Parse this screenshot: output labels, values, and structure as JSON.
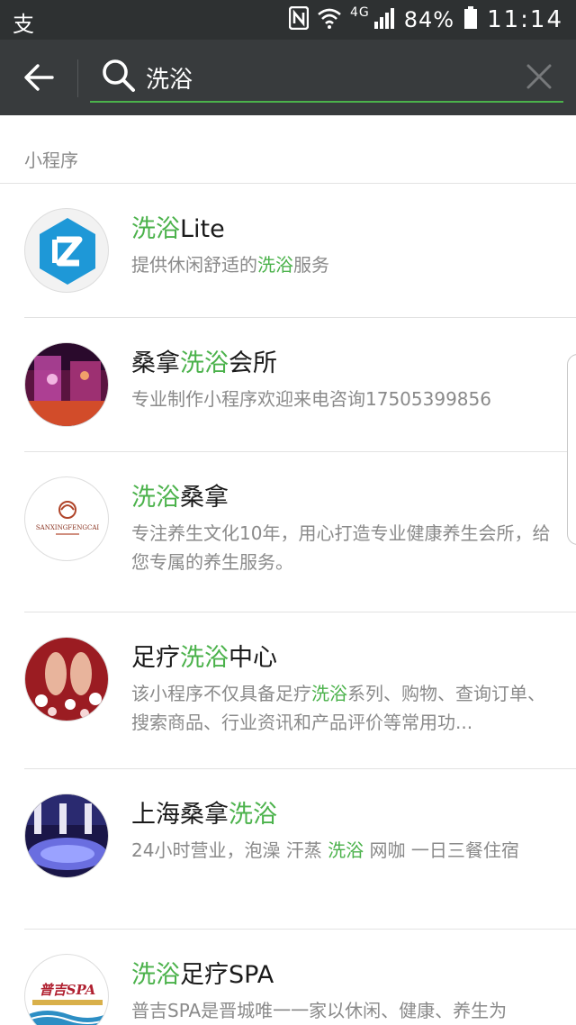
{
  "status_bar": {
    "left_glyph": "支",
    "network": "4G",
    "battery": "84%",
    "time": "11:14"
  },
  "search": {
    "query": "洗浴"
  },
  "section_title": "小程序",
  "results": [
    {
      "title": [
        {
          "t": "洗浴",
          "hl": true
        },
        {
          "t": "Lite",
          "hl": false
        }
      ],
      "desc": [
        {
          "t": "提供休闲舒适的",
          "hl": false
        },
        {
          "t": "洗浴",
          "hl": true
        },
        {
          "t": "服务",
          "hl": false
        }
      ],
      "avatar": "logo-z-icon"
    },
    {
      "title": [
        {
          "t": "桑拿",
          "hl": false
        },
        {
          "t": "洗浴",
          "hl": true
        },
        {
          "t": "会所",
          "hl": false
        }
      ],
      "desc": [
        {
          "t": "专业制作小程序欢迎来电咨询17505399856",
          "hl": false
        }
      ],
      "avatar": "interior-photo"
    },
    {
      "title": [
        {
          "t": "洗浴",
          "hl": true
        },
        {
          "t": "桑拿",
          "hl": false
        }
      ],
      "desc": [
        {
          "t": "专注养生文化10年，用心打造专业健康养生会所，给您专属的养生服务。",
          "hl": false
        }
      ],
      "avatar": "sanxing-logo",
      "avatar_text": "SANXINGFENGCAI"
    },
    {
      "title": [
        {
          "t": "足疗",
          "hl": false
        },
        {
          "t": "洗浴",
          "hl": true
        },
        {
          "t": "中心",
          "hl": false
        }
      ],
      "desc": [
        {
          "t": "该小程序不仅具备足疗",
          "hl": false
        },
        {
          "t": "洗浴",
          "hl": true
        },
        {
          "t": "系列、购物、查询订单、搜索商品、行业资讯和产品评价等常用功...",
          "hl": false
        }
      ],
      "avatar": "foot-spa-photo"
    },
    {
      "title": [
        {
          "t": "上海桑拿",
          "hl": false
        },
        {
          "t": "洗浴",
          "hl": true
        }
      ],
      "desc": [
        {
          "t": "24小时营业，泡澡 汗蒸 ",
          "hl": false
        },
        {
          "t": "洗浴",
          "hl": true
        },
        {
          "t": " 网咖 一日三餐住宿",
          "hl": false
        }
      ],
      "avatar": "pool-photo"
    },
    {
      "title": [
        {
          "t": "洗浴",
          "hl": true
        },
        {
          "t": "足疗SPA",
          "hl": false
        }
      ],
      "desc": [
        {
          "t": "普吉SPA是晋城唯一一家以休闲、健康、养生为",
          "hl": false
        }
      ],
      "avatar": "pujispa-logo",
      "avatar_text": "普吉SPA"
    }
  ],
  "colors": {
    "highlight": "#4bb24b",
    "topbar": "#383b3d",
    "statusbar": "#2e3132"
  }
}
